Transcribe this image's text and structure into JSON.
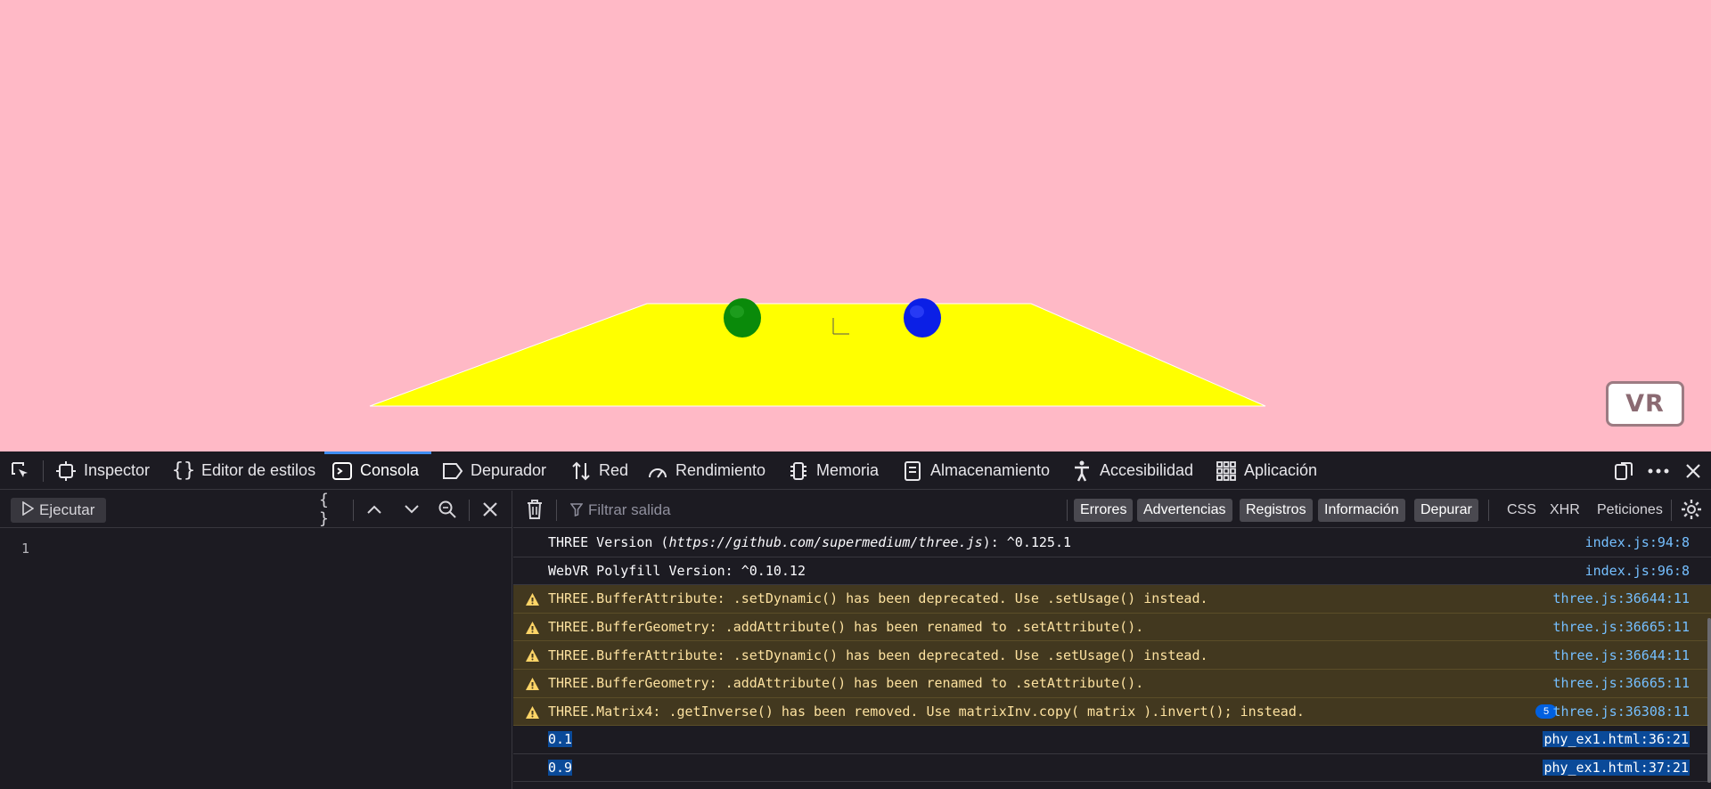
{
  "scene": {
    "background": "#ffb9c6",
    "plane_color": "#ffff00",
    "sphere_left_color": "#0a8a0a",
    "sphere_right_color": "#0b1fe6",
    "vr_button_label": "VR"
  },
  "devtools": {
    "tabs": [
      {
        "label": "Inspector",
        "icon": "inspector-icon"
      },
      {
        "label": "Editor de estilos",
        "icon": "braces-icon"
      },
      {
        "label": "Consola",
        "icon": "console-icon",
        "active": true
      },
      {
        "label": "Depurador",
        "icon": "debugger-icon"
      },
      {
        "label": "Red",
        "icon": "network-icon"
      },
      {
        "label": "Rendimiento",
        "icon": "performance-icon"
      },
      {
        "label": "Memoria",
        "icon": "memory-icon"
      },
      {
        "label": "Almacenamiento",
        "icon": "storage-icon"
      },
      {
        "label": "Accesibilidad",
        "icon": "accessibility-icon"
      },
      {
        "label": "Aplicación",
        "icon": "application-icon"
      }
    ],
    "editor": {
      "run_label": "Ejecutar",
      "line_number": "1"
    },
    "output": {
      "filter_placeholder": "Filtrar salida",
      "filters": [
        "Errores",
        "Advertencias",
        "Registros",
        "Información",
        "Depurar"
      ],
      "extra_filters": [
        "CSS",
        "XHR",
        "Peticiones"
      ],
      "messages": [
        {
          "type": "log",
          "text_prefix": "THREE Version (",
          "text_italic": "https://github.com/supermedium/three.js",
          "text_suffix": "): ^0.125.1",
          "source": "index.js:94:8"
        },
        {
          "type": "log",
          "text": "WebVR Polyfill Version: ^0.10.12",
          "source": "index.js:96:8"
        },
        {
          "type": "warn",
          "text": "THREE.BufferAttribute: .setDynamic() has been deprecated. Use .setUsage() instead.",
          "source": "three.js:36644:11"
        },
        {
          "type": "warn",
          "text": "THREE.BufferGeometry: .addAttribute() has been renamed to .setAttribute().",
          "source": "three.js:36665:11"
        },
        {
          "type": "warn",
          "text": "THREE.BufferAttribute: .setDynamic() has been deprecated. Use .setUsage() instead.",
          "source": "three.js:36644:11"
        },
        {
          "type": "warn",
          "text": "THREE.BufferGeometry: .addAttribute() has been renamed to .setAttribute().",
          "source": "three.js:36665:11"
        },
        {
          "type": "warn",
          "text": "THREE.Matrix4: .getInverse() has been removed. Use matrixInv.copy( matrix ).invert(); instead.",
          "source": "three.js:36308:11",
          "count": "5"
        },
        {
          "type": "log",
          "text": "0.1",
          "source": "phy_ex1.html:36:21"
        },
        {
          "type": "log",
          "text": "0.9",
          "source": "phy_ex1.html:37:21"
        }
      ]
    }
  }
}
